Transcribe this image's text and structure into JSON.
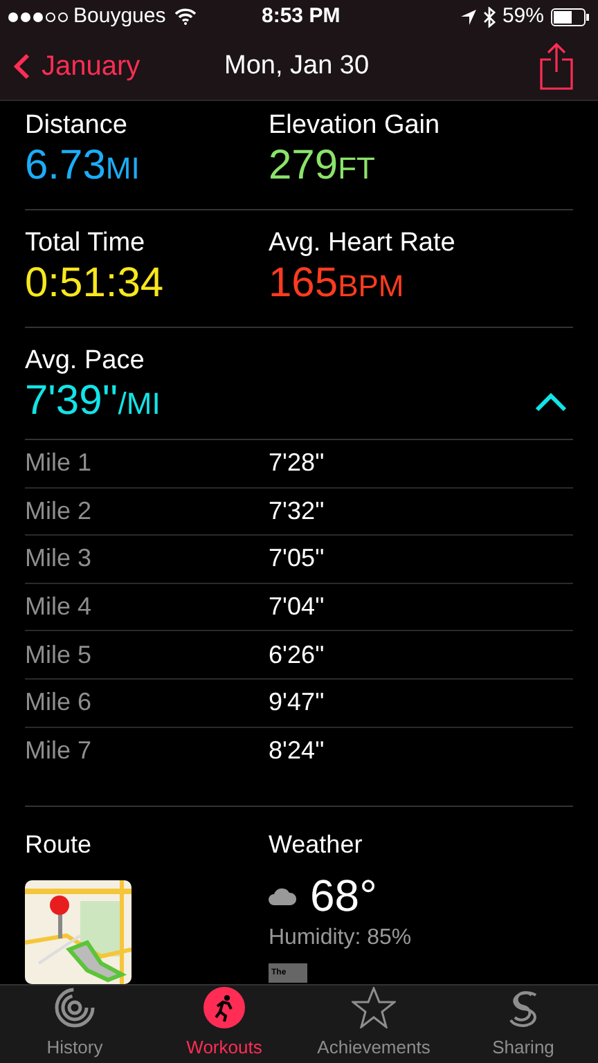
{
  "status_bar": {
    "carrier": "Bouygues",
    "time": "8:53 PM",
    "battery": "59%"
  },
  "nav": {
    "back": "January",
    "title": "Mon, Jan 30"
  },
  "stats": [
    {
      "label": "Distance",
      "value": "6.73",
      "unit": "MI",
      "color": "#1badf8"
    },
    {
      "label": "Elevation Gain",
      "value": "279",
      "unit": "FT",
      "color": "#8be36a"
    },
    {
      "label": "Total Time",
      "value": "0:51:34",
      "color": "#f8e71c"
    },
    {
      "label": "Avg. Heart Rate",
      "value": "165",
      "unit": "BPM",
      "color": "#ff3b1f"
    }
  ],
  "pace": {
    "label": "Avg. Pace",
    "value": "7'39''",
    "unit": "/MI",
    "expanded": true,
    "splits": [
      {
        "label": "Mile 1",
        "time": "7'28''"
      },
      {
        "label": "Mile 2",
        "time": "7'32''"
      },
      {
        "label": "Mile 3",
        "time": "7'05''"
      },
      {
        "label": "Mile 4",
        "time": "7'04''"
      },
      {
        "label": "Mile 5",
        "time": "6'26''"
      },
      {
        "label": "Mile 6",
        "time": "9'47''"
      },
      {
        "label": "Mile 7",
        "time": "8'24''"
      }
    ]
  },
  "route": {
    "label": "Route"
  },
  "weather": {
    "label": "Weather",
    "temperature": "68°",
    "humidity": "Humidity: 85%",
    "logo_text": "The"
  },
  "tabs": [
    {
      "label": "History",
      "selected": false
    },
    {
      "label": "Workouts",
      "selected": true
    },
    {
      "label": "Achievements",
      "selected": false
    },
    {
      "label": "Sharing",
      "selected": false
    }
  ]
}
